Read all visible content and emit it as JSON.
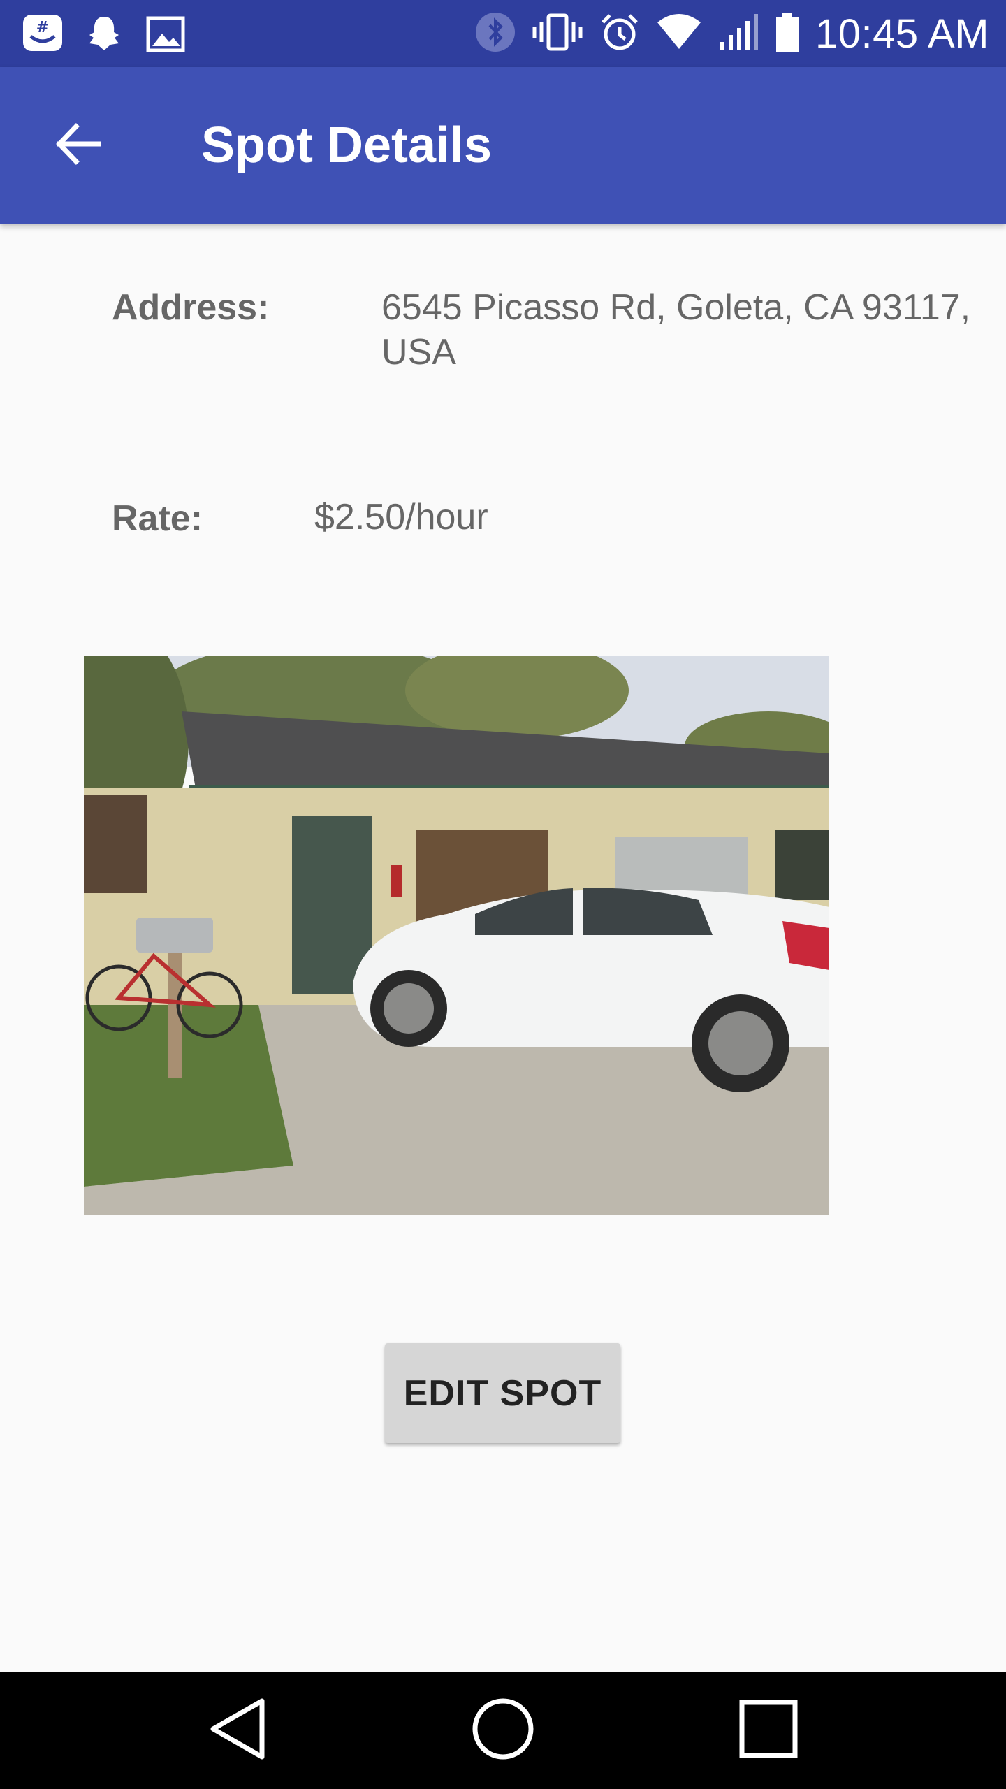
{
  "status_bar": {
    "time": "10:45 AM",
    "left_icons": [
      "groupme-icon",
      "snapchat-icon",
      "gallery-icon"
    ],
    "right_icons": [
      "bluetooth-icon",
      "vibrate-icon",
      "alarm-icon",
      "wifi-icon",
      "signal-icon",
      "battery-icon"
    ]
  },
  "app_bar": {
    "title": "Spot Details",
    "back_icon": "arrow-back-icon",
    "color": "#3f51b5"
  },
  "details": {
    "address_label": "Address:",
    "address_line1": "6545 Picasso Rd, Goleta, CA 93117,",
    "address_line2": "USA",
    "rate_label": "Rate:",
    "rate_value": "$2.50/hour"
  },
  "photo": {
    "subject": "parking-spot-photo"
  },
  "actions": {
    "edit_label": "EDIT SPOT"
  },
  "nav_bar": {
    "icons": [
      "nav-back-icon",
      "nav-home-icon",
      "nav-recents-icon"
    ]
  }
}
